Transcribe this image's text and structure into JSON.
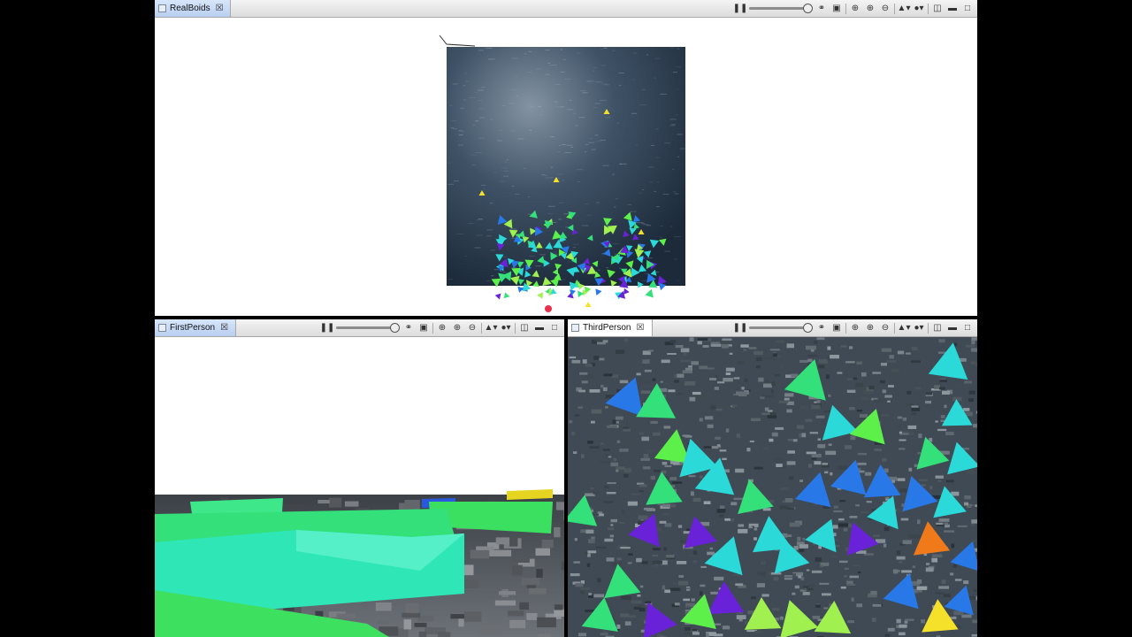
{
  "windows": {
    "top": {
      "title": "RealBoids"
    },
    "bottom_left": {
      "title": "FirstPerson"
    },
    "bottom_right": {
      "title": "ThirdPerson"
    }
  },
  "toolbar": {
    "close_glyph": "☒",
    "icons": [
      "pause-icon",
      "speed-slider",
      "link-icon",
      "camera-icon",
      "zoom-fit-icon",
      "zoom-in-icon",
      "zoom-out-icon",
      "viewpoint-menu-icon",
      "render-mode-icon",
      "layout-icon",
      "minimize-icon",
      "maximize-icon"
    ]
  },
  "colors": {
    "water_dark": "#1c2a3a",
    "water_light": "#7e8fa0",
    "tab_active": "#c6d9f5",
    "boid_palette": [
      "#2bd9d9",
      "#33e07a",
      "#5ef04a",
      "#2878e8",
      "#6a22d8",
      "#a0f050",
      "#f07a1a",
      "#f5e02a"
    ]
  }
}
